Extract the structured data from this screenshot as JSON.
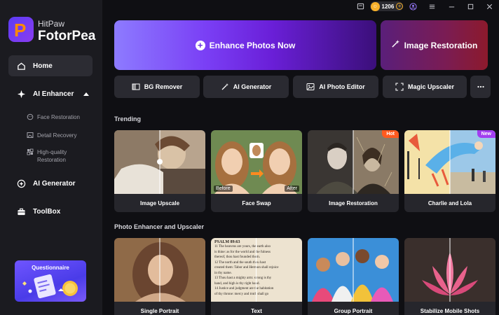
{
  "brand": {
    "top": "HitPaw",
    "main": "FotorPea"
  },
  "topbar": {
    "credits": "1206"
  },
  "sidebar": {
    "home": "Home",
    "ai_enhancer": "AI Enhancer",
    "sub_items": [
      "Face Restoration",
      "Detail Recovery",
      "High-quality Restoration"
    ],
    "ai_generator": "AI Generator",
    "toolbox": "ToolBox",
    "questionnaire": "Questionnaire"
  },
  "hero": {
    "enhance": "Enhance Photos Now",
    "restore": "Image Restoration"
  },
  "tools": [
    "BG Remover",
    "AI Generator",
    "AI Photo Editor",
    "Magic Upscaler"
  ],
  "sections": {
    "trending": "Trending",
    "photo_enhancer": "Photo Enhancer and Upscaler"
  },
  "trending_cards": [
    {
      "title": "Image Upscale",
      "badge": ""
    },
    {
      "title": "Face Swap",
      "badge": "",
      "before": "Before",
      "after": "After"
    },
    {
      "title": "Image Restoration",
      "badge": "Hot"
    },
    {
      "title": "Charlie and Lola",
      "badge": "New"
    }
  ],
  "enhancer_cards": [
    {
      "title": "Single Portrait"
    },
    {
      "title": "Text",
      "book_heading": "PSALM 89:63",
      "book_lines": [
        "11 The heavens are yours, the earth also",
        "is thine: as for the world and the fulness",
        "thereof, thou hast founded them.",
        "12 The north and the south thou hast",
        "created them: Tabor and Hermon shall rejoice",
        "in thy name.",
        "13 Thou hast a mighty arm: strong is thy",
        "hand, and high is thy right hand.",
        "14 Justice and judgment are the habitation",
        "of thy throne: mercy and truth shall go"
      ]
    },
    {
      "title": "Group Portrait"
    },
    {
      "title": "Stabilize Mobile Shots"
    }
  ],
  "colors": {
    "hot_badge": "#ff5a1f",
    "new_badge": "#a23ef0",
    "coin": "#f7b02a",
    "accent": "#7a3ff5"
  }
}
